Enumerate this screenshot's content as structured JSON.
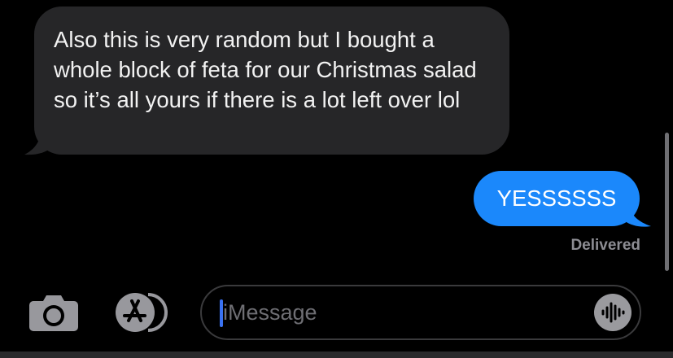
{
  "conversation": {
    "messages": [
      {
        "direction": "incoming",
        "text": "Also this is very random but I bought a whole block of feta for our Christmas salad so it’s all yours if there is a lot left over lol"
      },
      {
        "direction": "outgoing",
        "text": "YESSSSSS",
        "status": "Delivered"
      }
    ]
  },
  "composer": {
    "placeholder": "iMessage",
    "camera_icon": "camera-icon",
    "apps_icon": "app-store-icon",
    "audio_icon": "waveform-icon"
  },
  "colors": {
    "incoming_bubble": "#262628",
    "outgoing_bubble": "#1b88fb",
    "caret": "#3a72f2"
  }
}
